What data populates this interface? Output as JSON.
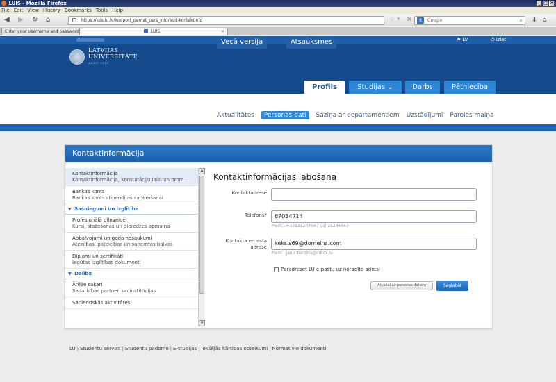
{
  "browser": {
    "window_title": "LUIS - Mozilla Firefox",
    "menu": [
      "File",
      "Edit",
      "View",
      "History",
      "Bookmarks",
      "Tools",
      "Help"
    ],
    "url": "https://luis.lu.lv/lu/dport_pamat_pers_info/edit-kontaktinfo",
    "search_placeholder": "Google",
    "tabs": [
      {
        "label": "Enter your username and password"
      },
      {
        "label": "LUIS"
      }
    ]
  },
  "site": {
    "top_links": [
      "Vecā versija",
      "Atsauksmes"
    ],
    "lang": "LV",
    "logout": "Iziet",
    "logo_line1": "LATVIJAS",
    "logo_line2": "UNIVERSITĀTE",
    "logo_year": "ANNO 1919",
    "main_tabs": [
      "Profils",
      "Studijas",
      "Darbs",
      "Pētniecība"
    ],
    "sub_nav": [
      "Aktualitātes",
      "Personas dati",
      "Saziņa ar departamentiem",
      "Uzstādījumi",
      "Paroles maiņa"
    ]
  },
  "panel": {
    "title": "Kontaktinformācija",
    "sidebar": {
      "item1_title": "Kontaktinformācija",
      "item1_sub": "Kontaktinformācija, Konsultāciju laiki un prom...",
      "item2_title": "Bankas konts",
      "item2_sub": "Bankas konts stipendijas saņemšanai",
      "section1": "Sasniegumi un izglītība",
      "item3_title": "Profesionālā pilnveide",
      "item3_sub": "Kursi, stažēšanās un pieredzes apmaiņa",
      "item4_title": "Apbalvojumi un goda nosaukumi",
      "item4_sub": "Atzinības, pateicības un saņemtās balvas",
      "item5_title": "Diplomi un sertifikāti",
      "item5_sub": "Iegūtās izglītības dokumenti",
      "section2": "Dalība",
      "item6_title": "Ārējie sakari",
      "item6_sub": "Sadarbības partneri un institūcijas",
      "item7_title": "Sabiedriskās aktivitātes"
    },
    "form": {
      "title": "Kontaktinformācijas labošana",
      "address_label": "Kontaktadrese",
      "address_value": "",
      "phone_label": "Telefons*",
      "phone_value": "67034714",
      "phone_hint": "Piem.: +37121234567 vai 21234567",
      "email_label_1": "Kontakta e-pasta",
      "email_label_2": "adrese",
      "email_value": "keksis69@domeins.com",
      "email_hint": "Piem.: janis.berzins@inbox.lv",
      "checkbox_label": "Pārādresēt LU e-pastu uz norādīto adresi",
      "back_button": "Atpakaļ uz personas datiem",
      "save_button": "Saglabāt"
    }
  },
  "footer": {
    "links": [
      "LU",
      "Studentu serviss",
      "Studentu padome",
      "E-studijas",
      "Iekšējās kārtības noteikumi",
      "Normatīvie dokumenti"
    ]
  }
}
